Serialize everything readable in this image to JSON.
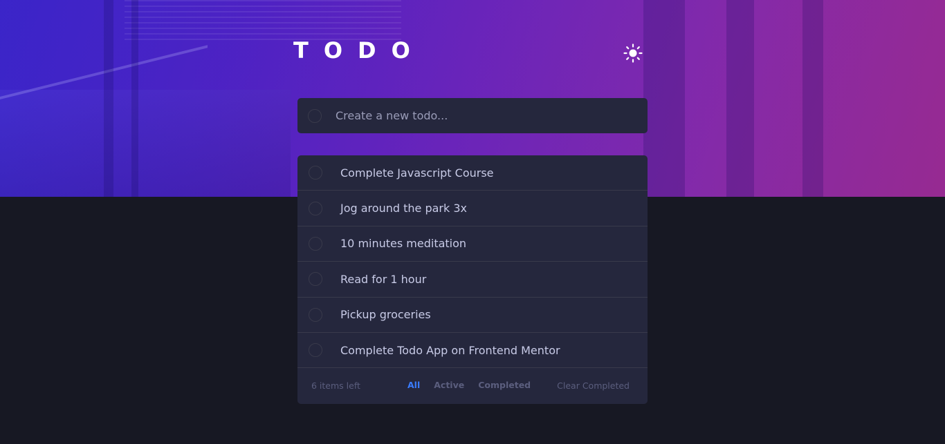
{
  "app": {
    "title": "TODO"
  },
  "new_todo": {
    "placeholder": "Create a new todo..."
  },
  "todos": [
    {
      "text": "Complete Javascript Course"
    },
    {
      "text": "Jog around the park 3x"
    },
    {
      "text": "10 minutes meditation"
    },
    {
      "text": "Read for 1 hour"
    },
    {
      "text": "Pickup groceries"
    },
    {
      "text": "Complete Todo App on Frontend Mentor"
    }
  ],
  "footer": {
    "items_left": "6 items left",
    "filters": {
      "all": "All",
      "active": "Active",
      "completed": "Completed"
    },
    "clear_label": "Clear Completed"
  },
  "icons": {
    "theme_toggle": "sun-icon"
  },
  "colors": {
    "accent": "#3a7cfd",
    "card_bg": "#25273d",
    "page_bg": "#171823",
    "text": "#c8cbe7",
    "muted": "#5b5e7e"
  }
}
